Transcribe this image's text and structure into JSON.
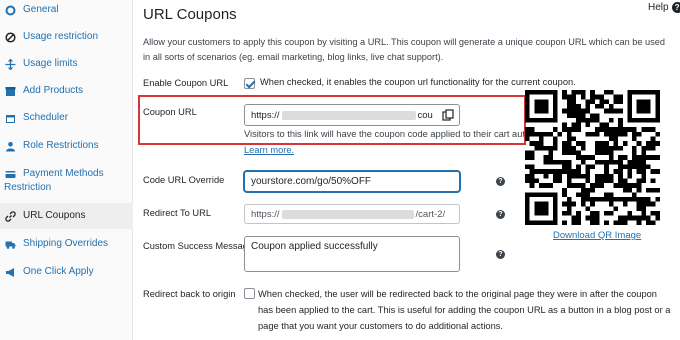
{
  "sidebar": {
    "items": [
      {
        "label": "General",
        "icon": "gear-icon"
      },
      {
        "label": "Usage restriction",
        "icon": "ban-icon"
      },
      {
        "label": "Usage limits",
        "icon": "arrows-icon"
      },
      {
        "label": "Add Products",
        "icon": "box-icon"
      },
      {
        "label": "Scheduler",
        "icon": "calendar-icon"
      },
      {
        "label": "Role Restrictions",
        "icon": "user-icon"
      },
      {
        "label": "Payment Methods",
        "label2": "Restriction",
        "icon": "card-icon"
      },
      {
        "label": "URL Coupons",
        "icon": "link-icon"
      },
      {
        "label": "Shipping Overrides",
        "icon": "truck-icon"
      },
      {
        "label": "One Click Apply",
        "icon": "megaphone-icon"
      }
    ]
  },
  "header": {
    "title": "URL Coupons",
    "help_label": "Help",
    "help_icon": "?"
  },
  "description": "Allow your customers to apply this coupon by visiting a URL. This coupon will generate a unique coupon URL which can be used in all sorts of scenarios (eg. email marketing, blog links, live chat support).",
  "enable": {
    "label": "Enable Coupon URL",
    "checked": true,
    "text": "When checked, it enables the coupon url functionality for the current coupon."
  },
  "coupon_url": {
    "label": "Coupon URL",
    "value_prefix": "https://",
    "value_suffix": "cou",
    "help_text": "Visitors to this link will have the coupon code applied to their cart autom",
    "learn_more": "Learn more."
  },
  "override": {
    "label": "Code URL Override",
    "value": "yourstore.com/go/50%OFF"
  },
  "redirect": {
    "label": "Redirect To URL",
    "value_prefix": "https://",
    "value_suffix": "/cart-2/"
  },
  "success": {
    "label": "Custom Success Message",
    "value": "Coupon applied successfully"
  },
  "redirect_back": {
    "label": "Redirect back to origin",
    "checked": false,
    "text": "When checked, the user will be redirected back to the original page they were in after the coupon has been applied to the cart. This is useful for adding the coupon URL as a button in a blog post or a page that you want your customers to do additional actions."
  },
  "qr": {
    "download_label": "Download QR Image"
  },
  "colors": {
    "accent": "#2271b1",
    "highlight": "#d63638"
  }
}
